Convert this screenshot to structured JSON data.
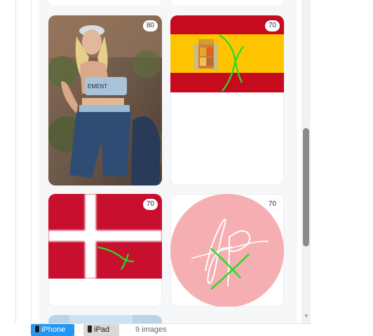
{
  "gallery": {
    "cards": [
      {
        "name": "photo-woman-rocks",
        "badge": "80"
      },
      {
        "name": "spain-flag",
        "badge": "70"
      },
      {
        "name": "denmark-flag",
        "badge": "70"
      },
      {
        "name": "fp-signature-logo",
        "badge": "70"
      }
    ]
  },
  "footer": {
    "iphone_label": "iPhone",
    "ipad_label": "iPad",
    "image_count": "9 images"
  },
  "colors": {
    "accent": "#2196f3",
    "spain_red": "#c60b1e",
    "spain_yellow": "#ffc400",
    "denmark_red": "#c8102e",
    "logo_pink": "#f5aeb1",
    "scribble_green": "#22dd22"
  }
}
